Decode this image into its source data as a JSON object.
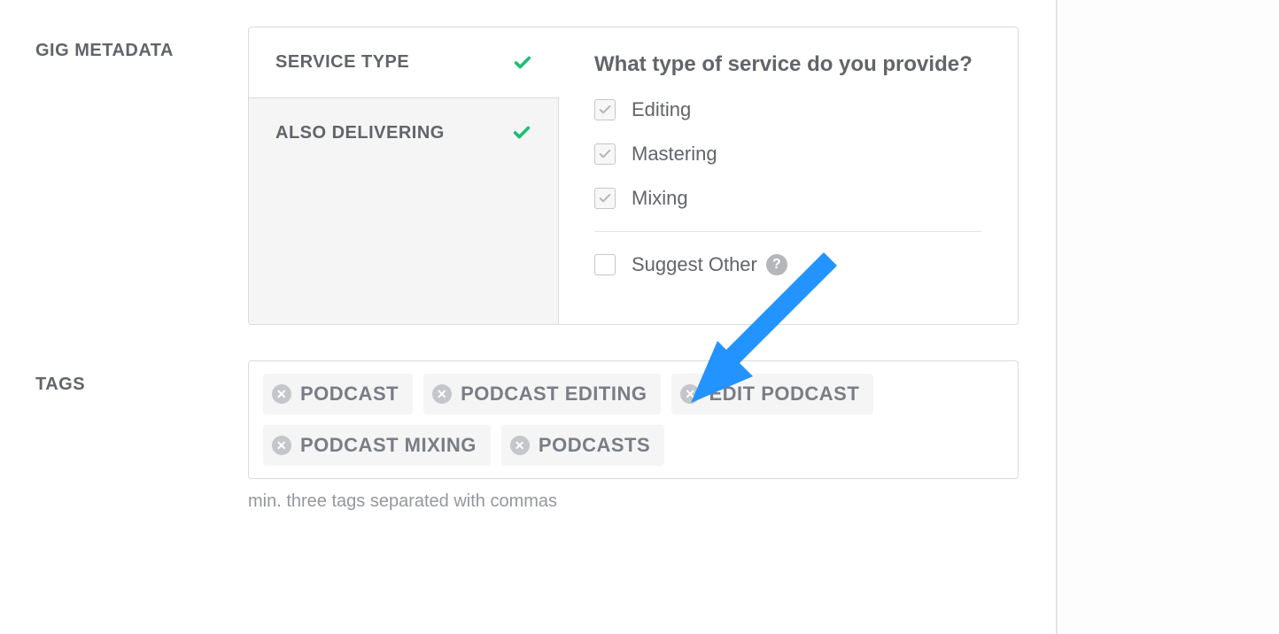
{
  "metadata": {
    "section_label": "GIG METADATA",
    "tabs": [
      {
        "label": "SERVICE TYPE",
        "complete": true,
        "active": true
      },
      {
        "label": "ALSO DELIVERING",
        "complete": true,
        "active": false
      }
    ],
    "heading": "What type of service do you provide?",
    "options": [
      {
        "label": "Editing",
        "checked": true
      },
      {
        "label": "Mastering",
        "checked": true
      },
      {
        "label": "Mixing",
        "checked": true
      }
    ],
    "suggest": {
      "label": "Suggest Other",
      "checked": false
    }
  },
  "tags": {
    "section_label": "TAGS",
    "items": [
      "PODCAST",
      "PODCAST EDITING",
      "EDIT PODCAST",
      "PODCAST MIXING",
      "PODCASTS"
    ],
    "hint": "min. three tags separated with commas"
  },
  "colors": {
    "check_green": "#1dbf73",
    "arrow_blue": "#1e90ff"
  }
}
